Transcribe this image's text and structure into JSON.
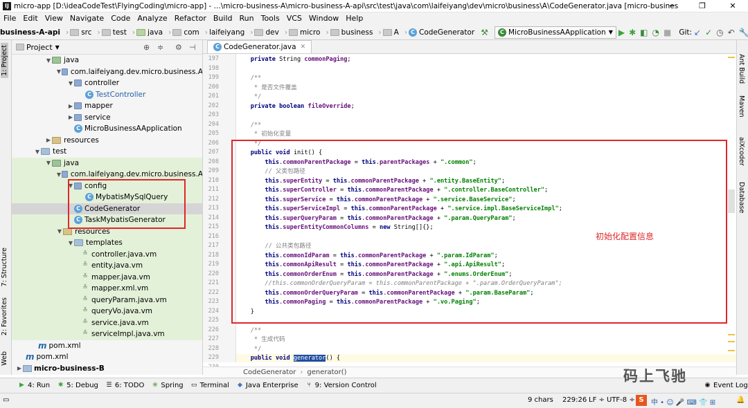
{
  "window": {
    "title": "micro-app [D:\\ideaCodeTest\\FlyingCoding\\micro-app] - ...\\micro-business-A\\micro-business-A-api\\src\\test\\java\\com\\laifeiyang\\dev\\micro\\business\\A\\CodeGenerator.java [micro-business-A-api] - IntelliJ I...",
    "app_icon": "IJ"
  },
  "menu": [
    "File",
    "Edit",
    "View",
    "Navigate",
    "Code",
    "Analyze",
    "Refactor",
    "Build",
    "Run",
    "Tools",
    "VCS",
    "Window",
    "Help"
  ],
  "nav": {
    "crumbs": [
      "business-A-api",
      "src",
      "test",
      "java",
      "com",
      "laifeiyang",
      "dev",
      "micro",
      "business",
      "A",
      "CodeGenerator"
    ],
    "run_config": "MicroBusinessAApplication",
    "git_label": "Git:"
  },
  "left_tabs": [
    "1: Project",
    "7: Structure",
    "2: Favorites",
    "Web"
  ],
  "right_tabs": [
    "Ant Build",
    "Maven",
    "aiXcoder",
    "Database"
  ],
  "project": {
    "header": "Project",
    "nodes": [
      {
        "label": "java",
        "icon": "folder"
      },
      {
        "label": "com.laifeiyang.dev.micro.business.A",
        "icon": "package"
      },
      {
        "label": "controller",
        "icon": "package"
      },
      {
        "label": "TestController",
        "icon": "class"
      },
      {
        "label": "mapper",
        "icon": "package"
      },
      {
        "label": "service",
        "icon": "package"
      },
      {
        "label": "MicroBusinessAApplication",
        "icon": "class"
      },
      {
        "label": "resources",
        "icon": "resource"
      },
      {
        "label": "test",
        "icon": "folder"
      },
      {
        "label": "java",
        "icon": "folder"
      },
      {
        "label": "com.laifeiyang.dev.micro.business.A",
        "icon": "package"
      },
      {
        "label": "config",
        "icon": "package"
      },
      {
        "label": "MybatisMySqlQuery",
        "icon": "class"
      },
      {
        "label": "CodeGenerator",
        "icon": "class"
      },
      {
        "label": "TaskMybatisGenerator",
        "icon": "class"
      },
      {
        "label": "resources",
        "icon": "resource"
      },
      {
        "label": "templates",
        "icon": "folder"
      },
      {
        "label": "controller.java.vm",
        "icon": "vm"
      },
      {
        "label": "entity.java.vm",
        "icon": "vm"
      },
      {
        "label": "mapper.java.vm",
        "icon": "vm"
      },
      {
        "label": "mapper.xml.vm",
        "icon": "vm"
      },
      {
        "label": "queryParam.java.vm",
        "icon": "vm"
      },
      {
        "label": "queryVo.java.vm",
        "icon": "vm"
      },
      {
        "label": "service.java.vm",
        "icon": "vm"
      },
      {
        "label": "serviceImpl.java.vm",
        "icon": "vm"
      },
      {
        "label": "pom.xml",
        "icon": "maven"
      },
      {
        "label": "pom.xml",
        "icon": "maven"
      },
      {
        "label": "micro-business-B",
        "icon": "module"
      }
    ]
  },
  "editor": {
    "tab": "CodeGenerator.java",
    "lines": [
      {
        "n": "197",
        "t": "    private String commonPaging;"
      },
      {
        "n": "198",
        "t": ""
      },
      {
        "n": "199",
        "t": "    /**"
      },
      {
        "n": "200",
        "t": "     * 是否文件覆盖"
      },
      {
        "n": "201",
        "t": "     */"
      },
      {
        "n": "202",
        "t": "    private boolean fileOverride;"
      },
      {
        "n": "203",
        "t": ""
      },
      {
        "n": "204",
        "t": "    /**"
      },
      {
        "n": "205",
        "t": "     * 初始化变量"
      },
      {
        "n": "206",
        "t": "     */"
      },
      {
        "n": "207",
        "t": "    public void init() {"
      },
      {
        "n": "208",
        "t": "        this.commonParentPackage = this.parentPackages + \".common\";"
      },
      {
        "n": "209",
        "t": "        // 父类包路径"
      },
      {
        "n": "210",
        "t": "        this.superEntity = this.commonParentPackage + \".entity.BaseEntity\";"
      },
      {
        "n": "211",
        "t": "        this.superController = this.commonParentPackage + \".controller.BaseController\";"
      },
      {
        "n": "212",
        "t": "        this.superService = this.commonParentPackage + \".service.BaseService\";"
      },
      {
        "n": "213",
        "t": "        this.superServiceImpl = this.commonParentPackage + \".service.impl.BaseServiceImpl\";"
      },
      {
        "n": "214",
        "t": "        this.superQueryParam = this.commonParentPackage + \".param.QueryParam\";"
      },
      {
        "n": "215",
        "t": "        this.superEntityCommonColumns = new String[]{};"
      },
      {
        "n": "216",
        "t": ""
      },
      {
        "n": "217",
        "t": "        // 公共类包路径"
      },
      {
        "n": "218",
        "t": "        this.commonIdParam = this.commonParentPackage + \".param.IdParam\";"
      },
      {
        "n": "219",
        "t": "        this.commonApiResult = this.commonParentPackage + \".api.ApiResult\";"
      },
      {
        "n": "220",
        "t": "        this.commonOrderEnum = this.commonParentPackage + \".enums.OrderEnum\";"
      },
      {
        "n": "221",
        "t": "        //this.commonOrderQueryParam = this.commonParentPackage + \".param.OrderQueryParam\";"
      },
      {
        "n": "222",
        "t": "        this.commonOrderQueryParam = this.commonParentPackage + \".param.BaseParam\";"
      },
      {
        "n": "223",
        "t": "        this.commonPaging = this.commonParentPackage + \".vo.Paging\";"
      },
      {
        "n": "224",
        "t": "    }"
      },
      {
        "n": "225",
        "t": ""
      },
      {
        "n": "226",
        "t": "    /**"
      },
      {
        "n": "227",
        "t": "     * 生成代码"
      },
      {
        "n": "228",
        "t": "     */"
      },
      {
        "n": "229",
        "t": "    public void generator() {"
      },
      {
        "n": "230",
        "t": "        // 代码生成器"
      }
    ],
    "annotation": "初始化配置信息",
    "breadcrumb": [
      "CodeGenerator",
      "generator()"
    ]
  },
  "tool_windows": [
    "4: Run",
    "5: Debug",
    "6: TODO",
    "Spring",
    "Terminal",
    "Java Enterprise",
    "9: Version Control"
  ],
  "status": {
    "chars": "9 chars",
    "position": "229:26",
    "line_sep": "LF ÷",
    "encoding": "UTF-8 ÷",
    "event_log": "Event Log"
  },
  "watermark": "码上飞驰",
  "colors": {
    "annotation_red": "#e0262a",
    "keyword": "#000080",
    "field": "#660e7a",
    "string": "#008000",
    "comment": "#808080"
  }
}
